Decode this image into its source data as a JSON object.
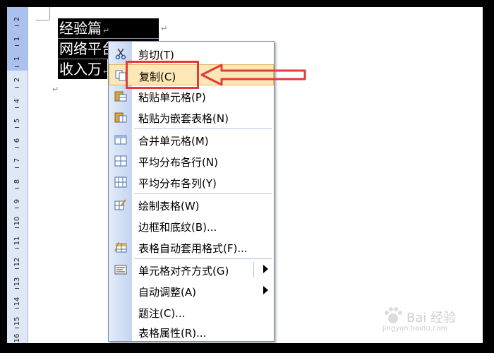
{
  "document": {
    "cells": [
      "经验篇",
      "网络平台",
      "收入万"
    ],
    "cell_end_mark": "↵",
    "para_mark": "↵"
  },
  "ruler": {
    "numbers": [
      "2",
      "1",
      "1",
      "2",
      "4",
      "5",
      "6",
      "7",
      "8",
      "9",
      "10",
      "11",
      "12",
      "13",
      "14",
      "15",
      "16"
    ]
  },
  "context_menu": {
    "items": [
      {
        "label": "剪切(T)",
        "icon": "scissors-icon",
        "highlighted": false
      },
      {
        "label": "复制(C)",
        "icon": "copy-icon",
        "highlighted": true
      },
      {
        "label": "粘贴单元格(P)",
        "icon": "paste-cells-icon"
      },
      {
        "label": "粘贴为嵌套表格(N)",
        "icon": "paste-nested-table-icon"
      },
      {
        "label": "合并单元格(M)",
        "icon": "merge-cells-icon"
      },
      {
        "label": "平均分布各行(N)",
        "icon": "distribute-rows-icon"
      },
      {
        "label": "平均分布各列(Y)",
        "icon": "distribute-columns-icon"
      },
      {
        "label": "绘制表格(W)",
        "icon": "draw-table-icon"
      },
      {
        "label": "边框和底纹(B)...",
        "icon": ""
      },
      {
        "label": "表格自动套用格式(F)...",
        "icon": "table-autoformat-icon"
      },
      {
        "label": "单元格对齐方式(G)",
        "icon": "cell-alignment-icon",
        "submenu": true
      },
      {
        "label": "自动调整(A)",
        "icon": "",
        "submenu": true
      },
      {
        "label": "题注(C)...",
        "icon": ""
      },
      {
        "label": "表格属性(R)...",
        "icon": ""
      }
    ]
  },
  "watermark": {
    "brand": "Bai 经验",
    "url": "jingyan.baidu.com"
  },
  "colors": {
    "highlight_fill": "#fde7b6",
    "annotation_red": "#e23b3b",
    "gutter": "#c4d5f0"
  }
}
